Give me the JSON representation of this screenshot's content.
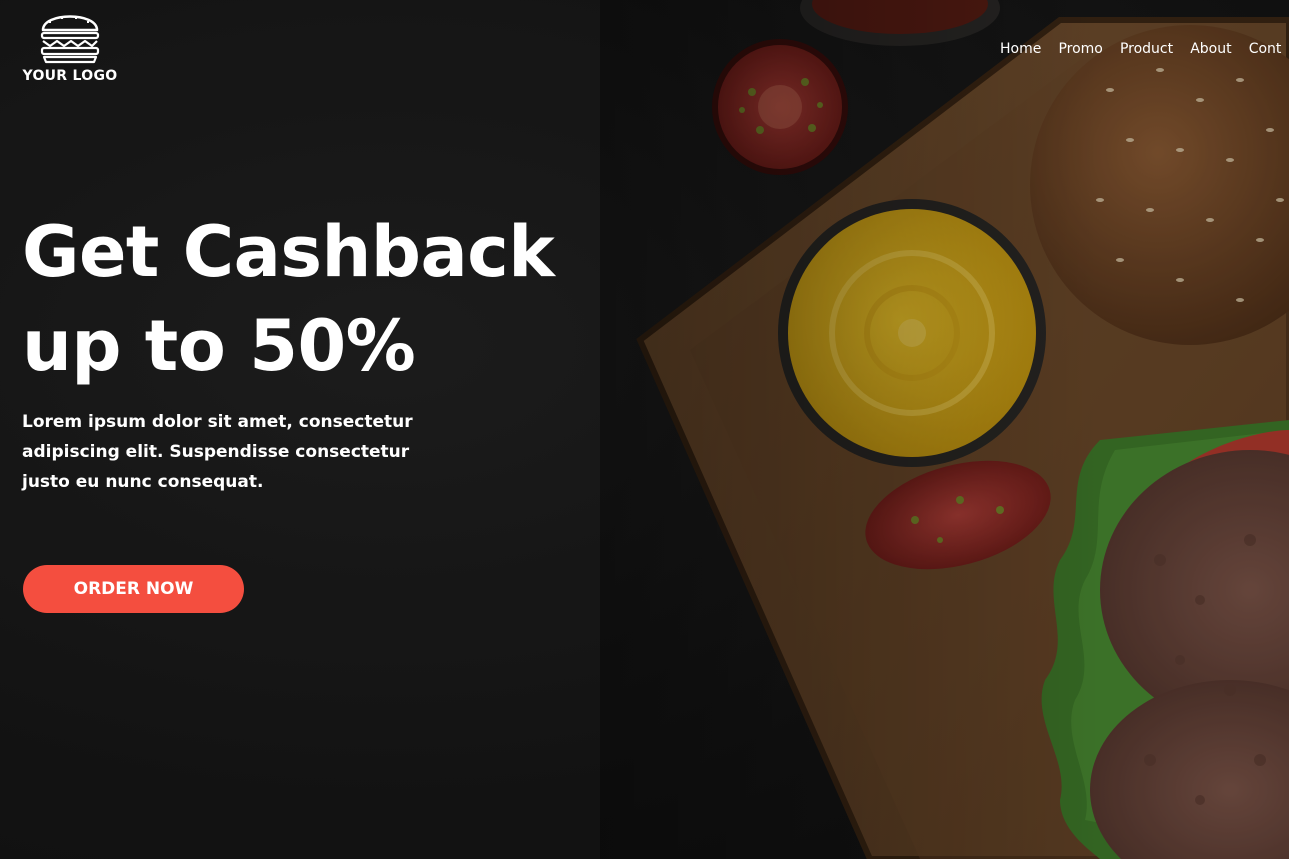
{
  "logo": {
    "text": "YOUR LOGO",
    "icon": "burger-icon"
  },
  "nav": {
    "items": [
      "Home",
      "Promo",
      "Product",
      "About",
      "Cont"
    ]
  },
  "hero": {
    "title_line1": "Get Cashback",
    "title_line2": "up to 50%",
    "description": "Lorem ipsum dolor sit amet, consectetur adipiscing elit. Suspendisse consectetur justo eu nunc consequat.",
    "cta_label": "ORDER NOW"
  },
  "colors": {
    "background": "#1a1a1a",
    "accent": "#f44e3f",
    "text": "#ffffff"
  }
}
